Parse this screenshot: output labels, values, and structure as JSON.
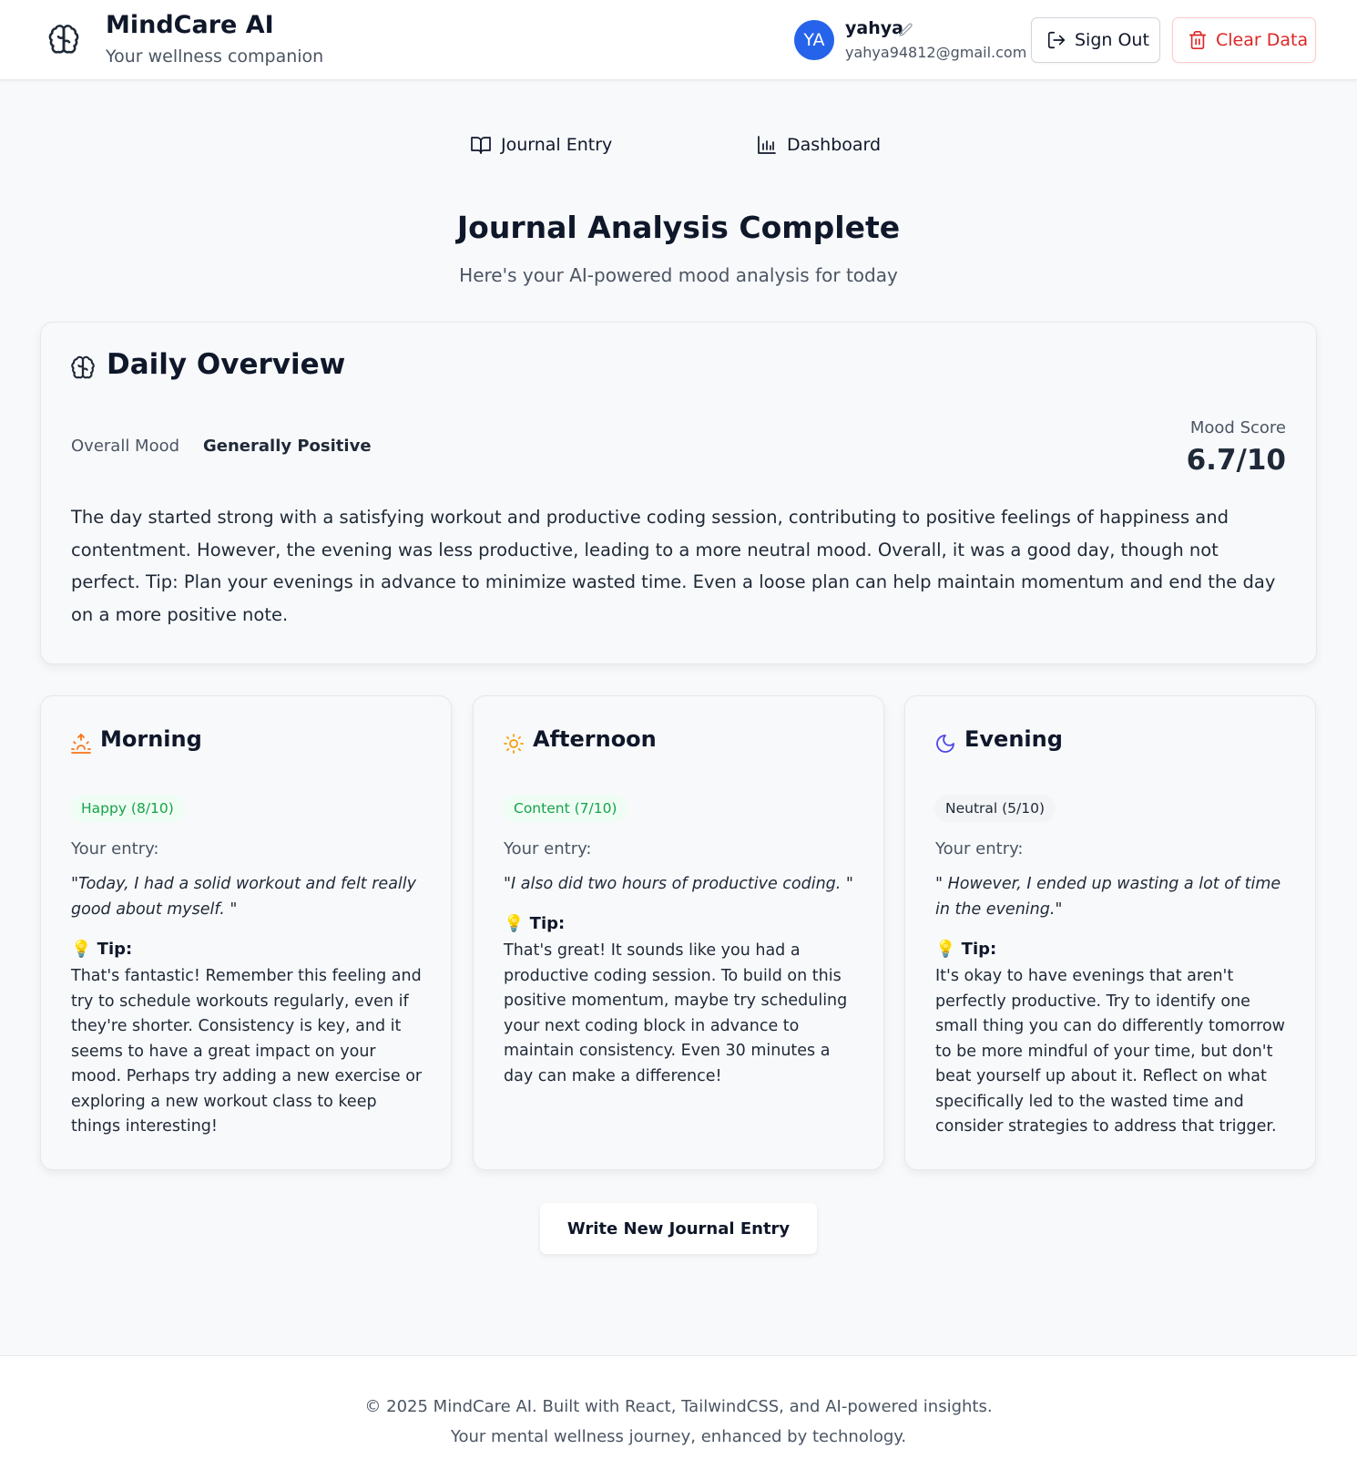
{
  "header": {
    "app_title": "MindCare AI",
    "app_subtitle": "Your wellness companion",
    "avatar_initials": "YA",
    "user_name": "yahya",
    "user_email": "yahya94812@gmail.com",
    "sign_out_label": "Sign Out",
    "clear_data_label": "Clear Data",
    "icons": {
      "logo": "brain-icon",
      "edit": "pencil-icon",
      "sign_out": "sign-out-icon",
      "clear": "trash-icon"
    }
  },
  "nav": {
    "tabs": [
      {
        "label": "Journal Entry",
        "icon": "book-open-icon"
      },
      {
        "label": "Dashboard",
        "icon": "bar-chart-icon"
      }
    ]
  },
  "main": {
    "title": "Journal Analysis Complete",
    "subtitle": "Here's your AI-powered mood analysis for today",
    "overview": {
      "title": "Daily Overview",
      "mood_label": "Overall Mood",
      "mood_value": "Generally Positive",
      "score_label": "Mood Score",
      "score_value": "6.7/10",
      "summary": "The day started strong with a satisfying workout and productive coding session, contributing to positive feelings of happiness and contentment. However, the evening was less productive, leading to a more neutral mood. Overall, it was a good day, though not perfect. Tip: Plan your evenings in advance to minimize wasted time. Even a loose plan can help maintain momentum and end the day on a more positive note."
    },
    "periods": [
      {
        "title": "Morning",
        "icon": "sunrise-icon",
        "badge": "Happy (8/10)",
        "entry_label": "Your entry:",
        "entry": "\"Today, I had a solid workout and felt really good about myself. \"",
        "tip_label": "💡 Tip:",
        "tip": "That's fantastic! Remember this feeling and try to schedule workouts regularly, even if they're shorter. Consistency is key, and it seems to have a great impact on your mood. Perhaps try adding a new exercise or exploring a new workout class to keep things interesting!"
      },
      {
        "title": "Afternoon",
        "icon": "sun-icon",
        "badge": "Content (7/10)",
        "entry_label": "Your entry:",
        "entry": "\"I also did two hours of productive coding. \"",
        "tip_label": "💡 Tip:",
        "tip": "That's great! It sounds like you had a productive coding session. To build on this positive momentum, maybe try scheduling your next coding block in advance to maintain consistency. Even 30 minutes a day can make a difference!"
      },
      {
        "title": "Evening",
        "icon": "moon-icon",
        "badge": "Neutral (5/10)",
        "entry_label": "Your entry:",
        "entry": "\" However, I ended up wasting a lot of time in the evening.\"",
        "tip_label": "💡 Tip:",
        "tip": "It's okay to have evenings that aren't perfectly productive. Try to identify one small thing you can do differently tomorrow to be more mindful of your time, but don't beat yourself up about it. Reflect on what specifically led to the wasted time and consider strategies to address that trigger."
      }
    ],
    "write_button_label": "Write New Journal Entry"
  },
  "footer": {
    "line1": "© 2025 MindCare AI. Built with React, TailwindCSS, and AI-powered insights.",
    "line2": "Your mental wellness journey, enhanced by technology."
  },
  "colors": {
    "avatar": "#2563eb",
    "danger": "#dc2626",
    "positive_badge_text": "#16a34a",
    "positive_badge_bg": "#f0fdf4",
    "morning_icon": "#f97316",
    "afternoon_icon": "#f59e0b",
    "evening_icon": "#4f46e5"
  }
}
